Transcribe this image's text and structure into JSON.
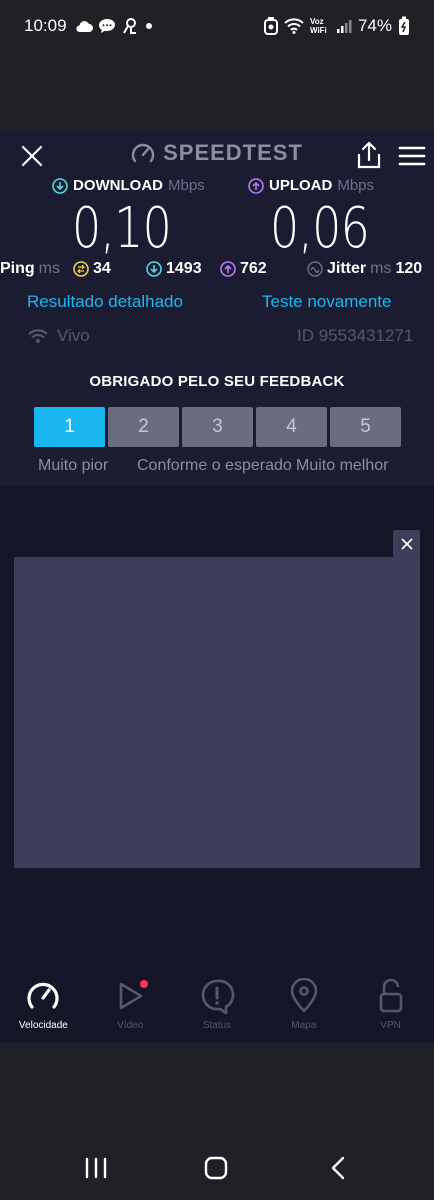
{
  "status_bar": {
    "time": "10:09",
    "network_label": "Voz WiFi",
    "battery": "74%"
  },
  "app": {
    "title": "SPEEDTEST",
    "download": {
      "label": "DOWNLOAD",
      "unit": "Mbps",
      "value": "0,10"
    },
    "upload": {
      "label": "UPLOAD",
      "unit": "Mbps",
      "value": "0,06"
    },
    "ping": {
      "label": "Ping",
      "unit": "ms",
      "idle": "34",
      "download": "1493",
      "upload": "762"
    },
    "jitter": {
      "label": "Jitter",
      "unit": "ms",
      "value": "120"
    },
    "links": {
      "detailed": "Resultado detalhado",
      "retest": "Teste novamente"
    },
    "provider": "Vivo",
    "result_id": "ID 9553431271",
    "feedback": {
      "title": "OBRIGADO PELO SEU FEEDBACK",
      "options": [
        "1",
        "2",
        "3",
        "4",
        "5"
      ],
      "selected": "1",
      "scale_labels": {
        "worse": "Muito pior",
        "expected": "Conforme o esperado",
        "better": "Muito melhor"
      }
    },
    "tabs": [
      {
        "label": "Velocidade",
        "icon": "speedometer-icon",
        "active": true
      },
      {
        "label": "Vídeo",
        "icon": "play-icon",
        "active": false
      },
      {
        "label": "Status",
        "icon": "alert-icon",
        "active": false
      },
      {
        "label": "Mapa",
        "icon": "map-pin-icon",
        "active": false
      },
      {
        "label": "VPN",
        "icon": "lock-open-icon",
        "active": false
      }
    ]
  },
  "colors": {
    "accent": "#1cb6f0",
    "background": "#141527",
    "panel": "#1b1c32",
    "download_icon": "#4dd9e6",
    "upload_icon": "#b877f0",
    "ping_icon": "#f2d24a",
    "notification_dot": "#ff3355"
  }
}
